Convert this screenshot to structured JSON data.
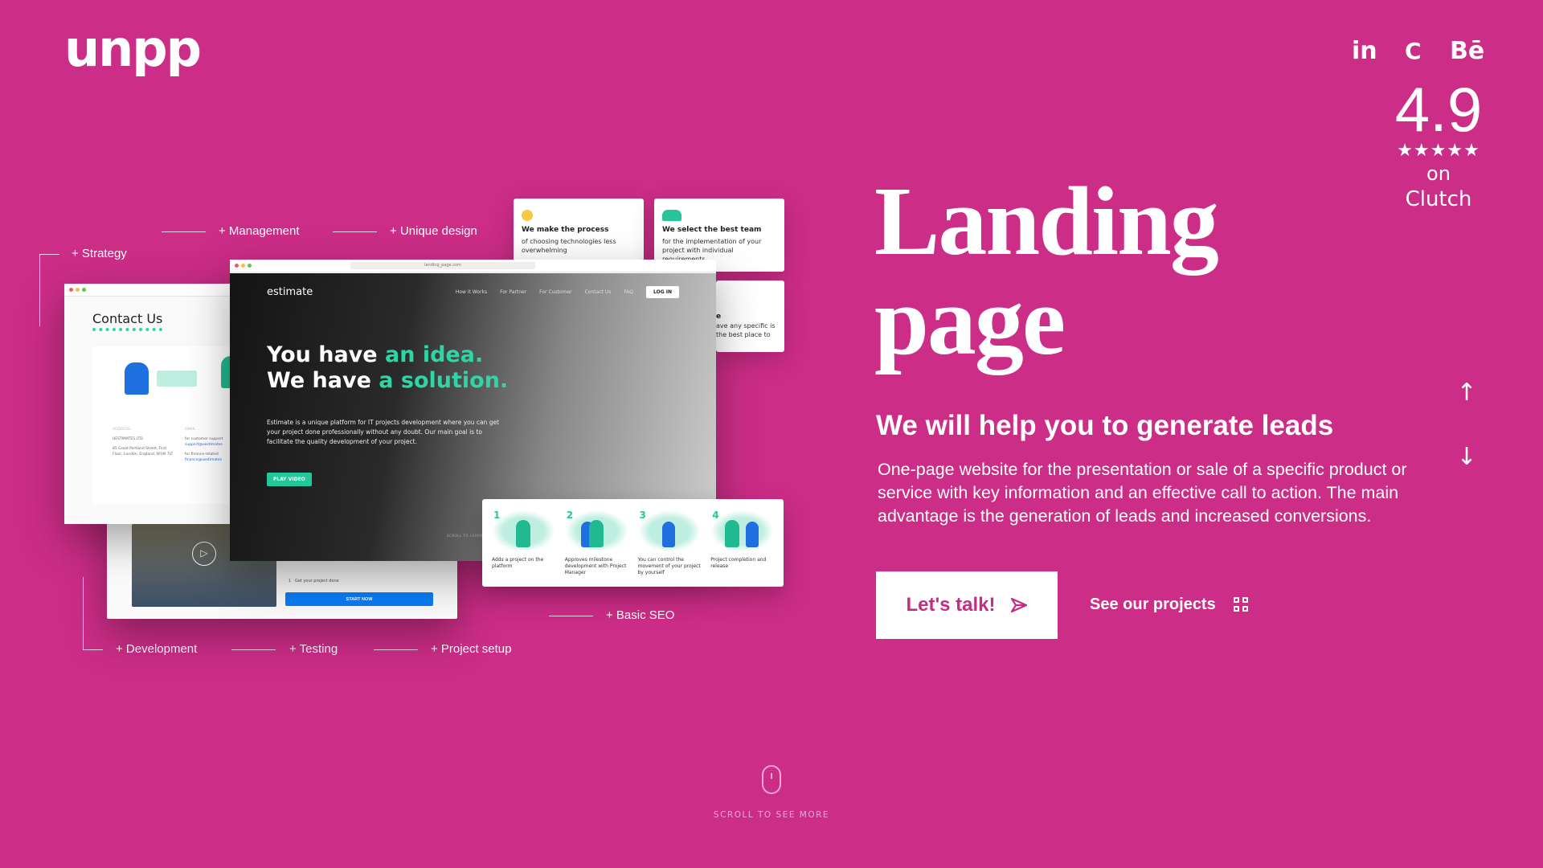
{
  "brand": {
    "logo": "unpp"
  },
  "social": [
    {
      "label": "in",
      "icon": "linkedin-icon"
    },
    {
      "label": "C",
      "icon": "clutch-icon"
    },
    {
      "label": "Bē",
      "icon": "behance-icon"
    }
  ],
  "rating": {
    "score": "4.9",
    "stars": "★★★★★",
    "stars_value": 5,
    "prefix": "on",
    "platform": "Clutch"
  },
  "hero": {
    "title_line1": "Landing",
    "title_line2": "page",
    "subtitle": "We will help you to generate leads",
    "description": "One-page website for the presentation or sale of a specific product or service with key information and an effective call to action. The main advantage is the generation of leads and increased conversions.",
    "cta": "Let's talk!",
    "secondary": "See our projects"
  },
  "scroll": {
    "label": "SCROLL TO SEE MORE"
  },
  "labels": {
    "strategy": "+ Strategy",
    "management": "+ Management",
    "unique_design": "+ Unique design",
    "basic_seo": "+ Basic SEO",
    "development": "+ Development",
    "testing": "+ Testing",
    "project_setup": "+ Project setup"
  },
  "mockup": {
    "cards": [
      {
        "title": "We make the process",
        "text": "of choosing technologies less overwhelming"
      },
      {
        "title": "We select the best team",
        "text": "for the implementation of your project with individual requirements"
      },
      {
        "title": "e",
        "text": "ave any specific is the best place to"
      }
    ],
    "url": "landing_page.com",
    "brand": "estimate",
    "nav": [
      "How it Works",
      "For Partner",
      "For Customer",
      "Contact Us",
      "FAQ"
    ],
    "login": "LOG IN",
    "headline_a": "You have ",
    "headline_a_accent": "an idea.",
    "headline_b": "We have ",
    "headline_b_accent": "a solution.",
    "paragraph": "Estimate is a unique platform for IT projects development where you can get your project done professionally without any doubt. Our main goal is to facilitate the quality development of your project.",
    "play": "PLAY VIDEO",
    "scroll_to_learn": "SCROLL TO LEARN",
    "contact": {
      "title": "Contact Us",
      "address_label": "ADDRESS",
      "company": "UESTIMATES LTD",
      "address": "85 Great Portland Street, First Floor, London, England, W1W 7LT",
      "email_label": "EMAIL",
      "support_text": "for customer support",
      "support_email": "support@uestimates",
      "finance_text": "for finance-related",
      "finance_email": "finance@uestimates"
    },
    "form": {
      "step": "1",
      "step_text": "Get your project done",
      "button": "START NOW"
    },
    "steps": [
      {
        "n": "1",
        "text": "Adds a project on the platform"
      },
      {
        "n": "2",
        "text": "Approves milestone development with Project Manager"
      },
      {
        "n": "3",
        "text": "You can control the movement of your project by yourself"
      },
      {
        "n": "4",
        "text": "Project completion and release"
      }
    ]
  },
  "colors": {
    "background": "#cc2d87",
    "accent": "#2ed6a5",
    "cta_text": "#c42d85",
    "start_button": "#0a7cf5"
  }
}
